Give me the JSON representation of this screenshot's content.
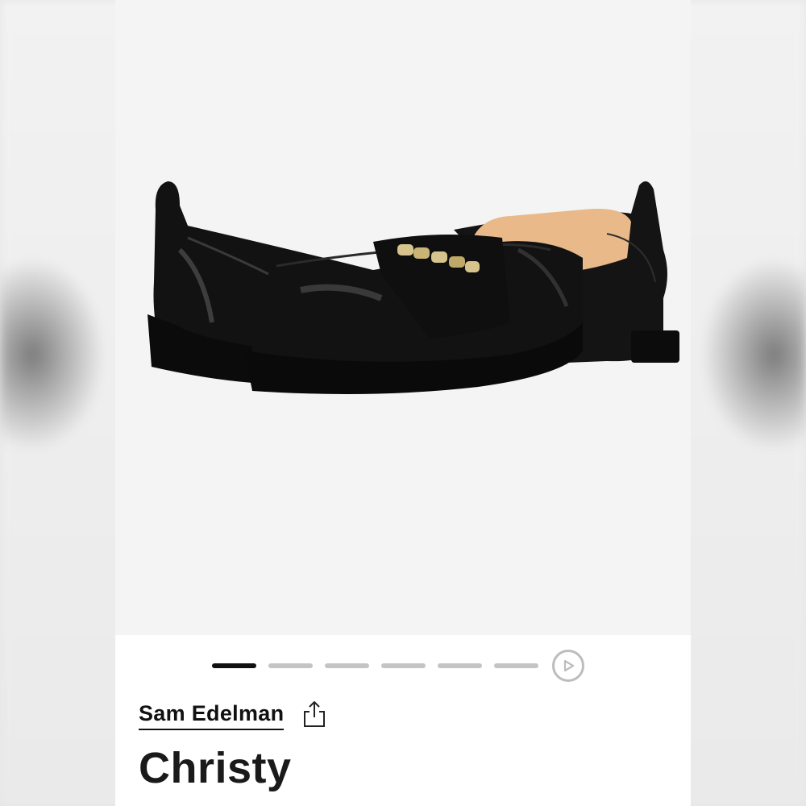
{
  "product": {
    "brand": "Sam Edelman",
    "name": "Christy"
  },
  "gallery": {
    "image_subject": "black leather loafers with gold chain detail",
    "slide_count": 6,
    "active_slide": 1
  },
  "icons": {
    "play": "play-circle-icon",
    "share": "share-icon"
  },
  "colors": {
    "active_indicator": "#111111",
    "inactive_indicator": "#c4c4c4",
    "gallery_bg": "#f4f4f4"
  }
}
